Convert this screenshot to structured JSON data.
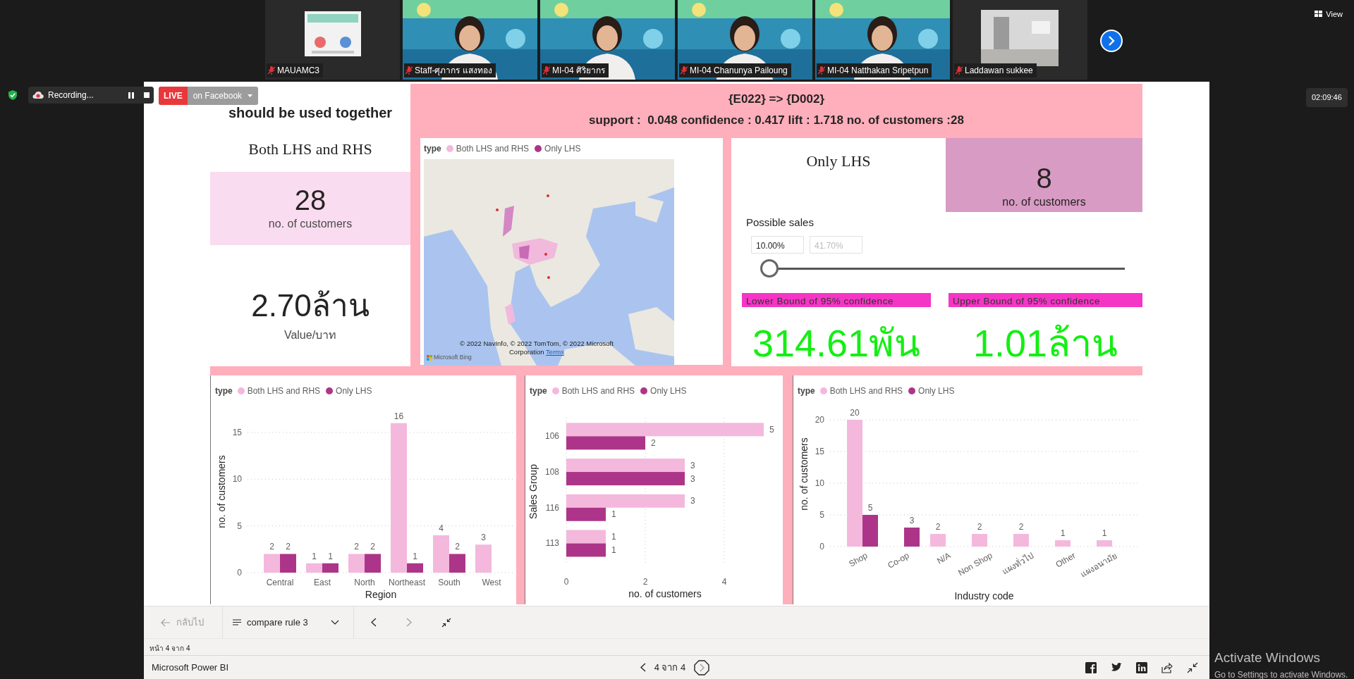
{
  "meeting": {
    "participants": [
      {
        "name": "MAUAMC3",
        "muted": true
      },
      {
        "name": "Staff-ศุภากร แสงทอง",
        "muted": true
      },
      {
        "name": "MI-04 ศิริยากร",
        "muted": true
      },
      {
        "name": "MI-04 Chanunya Pailoung",
        "muted": true
      },
      {
        "name": "MI-04 Natthakan Sripetpun",
        "muted": true
      },
      {
        "name": "Laddawan sukkee",
        "muted": true
      }
    ],
    "view_label": "View",
    "recording": "Recording...",
    "live_badge": "LIVE",
    "live_target": "on Facebook",
    "clock": "02:09:46"
  },
  "report": {
    "title": "should be used together",
    "rule": "{E022} => {D002}",
    "metrics": "support :  0.048 confidence : 0.417 lift : 1.718 no. of customers :28",
    "both": {
      "heading": "Both LHS and RHS",
      "count": "28",
      "count_label": "no. of customers",
      "value": "2.70ล้าน",
      "value_label": "Value/บาท"
    },
    "map": {
      "legend_title": "type",
      "legend": [
        {
          "name": "Both LHS and RHS",
          "color": "#f4b8dd"
        },
        {
          "name": "Only LHS",
          "color": "#ad3589"
        }
      ],
      "attribution": "© 2022 NavInfo, © 2022 TomTom, © 2022 Microsoft Corporation",
      "terms": "Terms",
      "provider": "Microsoft Bing"
    },
    "only": {
      "heading": "Only LHS",
      "count": "8",
      "count_label": "no. of customers"
    },
    "possible_sales": {
      "label": "Possible sales",
      "min": "10.00%",
      "max": "41.70%",
      "level": 0,
      "lower_label": "Lower Bound of 95% confidence",
      "lower_value": "314.61พัน",
      "upper_label": "Upper Bound of 95% confidence",
      "upper_value": "1.01ล้าน"
    },
    "charts": [
      {
        "chart_data": {
          "type": "bar",
          "orientation": "vertical",
          "legend": {
            "title": "type"
          },
          "grid": true,
          "xlabel": "Region",
          "ylabel": "no. of customers",
          "categories": [
            "Central",
            "East",
            "North",
            "Northeast",
            "South",
            "West"
          ],
          "series": [
            {
              "name": "Both LHS and RHS",
              "color": "#f4b8dd",
              "values": [
                2,
                1,
                2,
                16,
                4,
                3
              ]
            },
            {
              "name": "Only LHS",
              "color": "#ad3589",
              "values": [
                2,
                1,
                2,
                1,
                2,
                null
              ]
            }
          ],
          "ylim": [
            0,
            16
          ],
          "yticks": [
            0,
            5,
            10,
            15
          ],
          "data_labels": true
        }
      },
      {
        "chart_data": {
          "type": "bar",
          "orientation": "horizontal",
          "legend": {
            "title": "type"
          },
          "grid": true,
          "xlabel": "no. of customers",
          "ylabel": "Sales Group",
          "categories": [
            "106",
            "108",
            "116",
            "113"
          ],
          "series": [
            {
              "name": "Both LHS and RHS",
              "color": "#f4b8dd",
              "values": [
                5,
                3,
                3,
                1
              ]
            },
            {
              "name": "Only LHS",
              "color": "#ad3589",
              "values": [
                2,
                3,
                1,
                1
              ]
            }
          ],
          "xlim": [
            0,
            5
          ],
          "xticks": [
            0,
            2,
            4
          ],
          "data_labels": true
        }
      },
      {
        "chart_data": {
          "type": "bar",
          "orientation": "vertical",
          "legend": {
            "title": "type"
          },
          "grid": true,
          "xlabel": "Industry code",
          "ylabel": "no. of customers",
          "categories": [
            "Shop",
            "Co-op",
            "N/A",
            "Non Shop",
            "แผงทั่วไป",
            "Other",
            "แผงอนามัย"
          ],
          "series": [
            {
              "name": "Both LHS and RHS",
              "color": "#f4b8dd",
              "values": [
                20,
                null,
                2,
                2,
                2,
                1,
                1
              ]
            },
            {
              "name": "Only LHS",
              "color": "#ad3589",
              "values": [
                5,
                3,
                null,
                null,
                null,
                null,
                null
              ]
            }
          ],
          "ylim": [
            0,
            20
          ],
          "yticks": [
            0,
            5,
            10,
            15,
            20
          ],
          "data_labels": true
        }
      }
    ]
  },
  "viewer": {
    "back": "กลับไป",
    "back_disabled": true,
    "page_name": "compare rule 3",
    "next_disabled": true,
    "page_status": "หน้า 4 จาก 4",
    "app_name": "Microsoft Power BI",
    "pager": "4 จาก 4"
  },
  "os": {
    "activation_title": "Activate Windows",
    "activation_text": "Go to Settings to activate Windows."
  }
}
